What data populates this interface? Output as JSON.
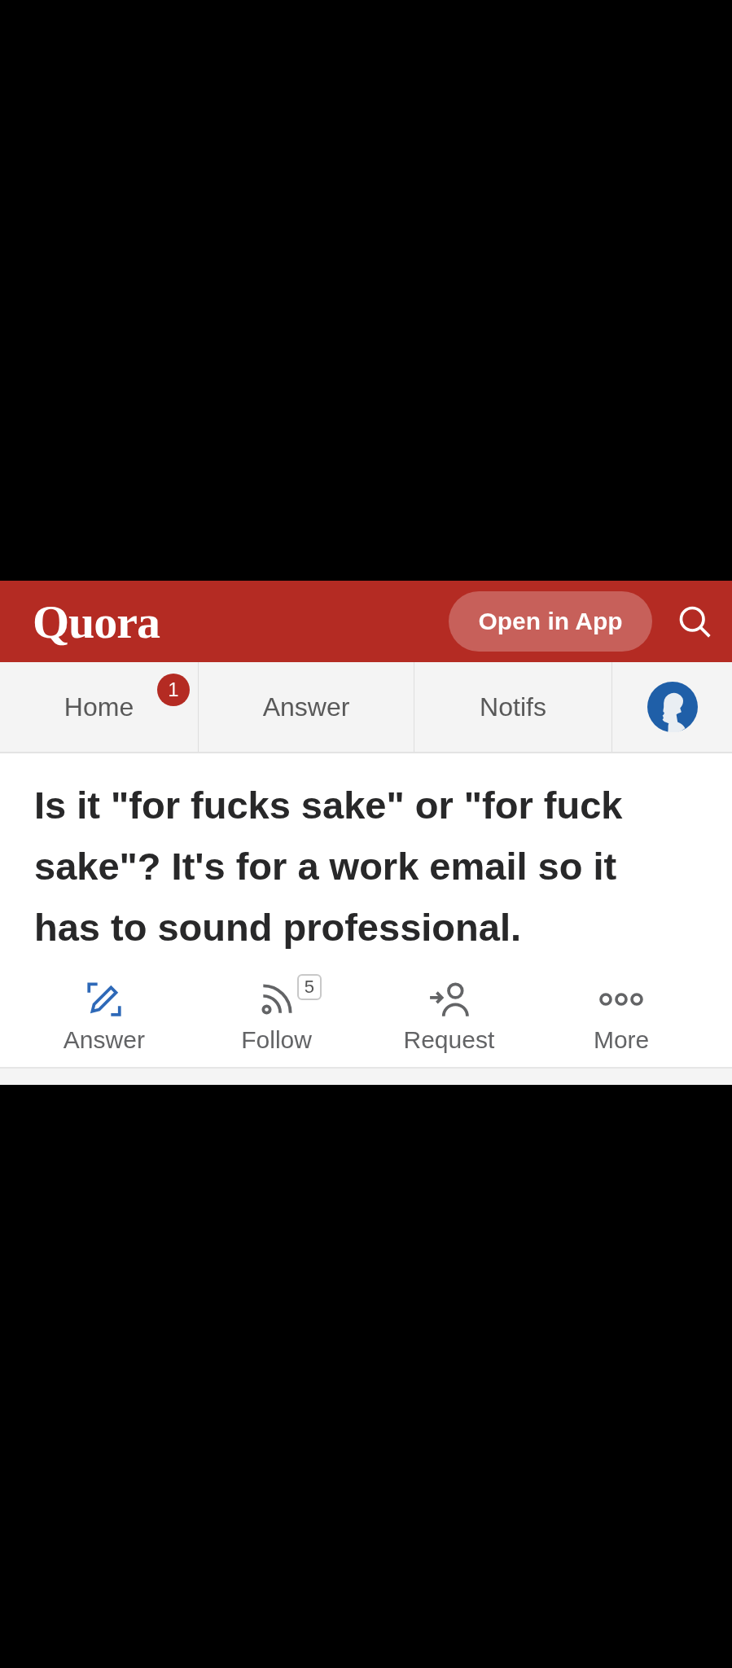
{
  "header": {
    "logo": "Quora",
    "open_app_button": "Open in App"
  },
  "nav": {
    "tabs": [
      {
        "label": "Home",
        "badge": "1"
      },
      {
        "label": "Answer"
      },
      {
        "label": "Notifs"
      }
    ]
  },
  "question": {
    "title": "Is it \"for fucks sake\" or \"for fuck sake\"? It's for a work email so it has to sound professional.",
    "actions": [
      {
        "kind": "answer",
        "label": "Answer"
      },
      {
        "kind": "follow",
        "label": "Follow",
        "count": "5"
      },
      {
        "kind": "request",
        "label": "Request"
      },
      {
        "kind": "more",
        "label": "More"
      }
    ]
  }
}
